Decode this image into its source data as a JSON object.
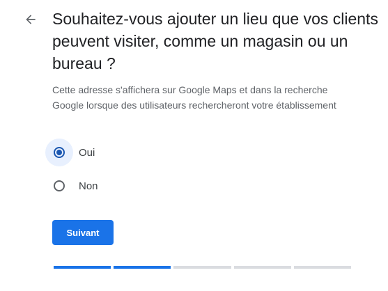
{
  "header": {
    "title": "Souhaitez-vous ajouter un lieu que vos clients peuvent visiter, comme un magasin ou un bureau ?"
  },
  "description": "Cette adresse s'affichera sur Google Maps et dans la recherche Google lorsque des utilisateurs rechercheront votre établissement",
  "options": [
    {
      "label": "Oui",
      "checked": true
    },
    {
      "label": "Non",
      "checked": false
    }
  ],
  "next_button": {
    "label": "Suivant"
  },
  "progress": {
    "completed_steps": 2,
    "total_steps": 5
  },
  "colors": {
    "accent": "#1a73e8",
    "radio_selected": "#1a56b0",
    "radio_halo": "#e8f0fe",
    "progress_inactive": "#dadce0",
    "text_secondary": "#5f6368"
  },
  "icons": {
    "back": "arrow-left-icon"
  }
}
